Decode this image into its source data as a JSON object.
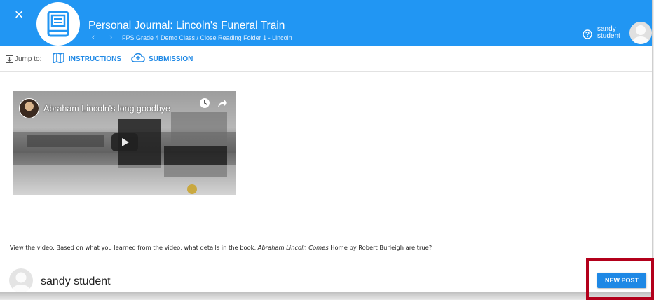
{
  "header": {
    "close_glyph": "×",
    "title": "Personal Journal: Lincoln's Funeral Train",
    "breadcrumb": "FPS Grade 4 Demo Class / Close Reading Folder 1 - Lincoln",
    "user_first": "sandy",
    "user_last": "student",
    "brand_color": "#2196f3"
  },
  "jumpbar": {
    "label": "Jump to:",
    "links": [
      {
        "label": "INSTRUCTIONS",
        "icon": "map-icon"
      },
      {
        "label": "SUBMISSION",
        "icon": "cloud-upload-icon"
      }
    ]
  },
  "video": {
    "title": "Abraham Lincoln's long goodbye"
  },
  "prompt": {
    "before": "View the video.  Based on what you learned from the video, what details in the book, ",
    "italic": "Abraham Lincoln Comes",
    "after": " Home by Robert Burleigh are true?"
  },
  "post": {
    "author": "sandy student",
    "new_post_label": "NEW POST",
    "highlight_color": "#b3001b"
  }
}
